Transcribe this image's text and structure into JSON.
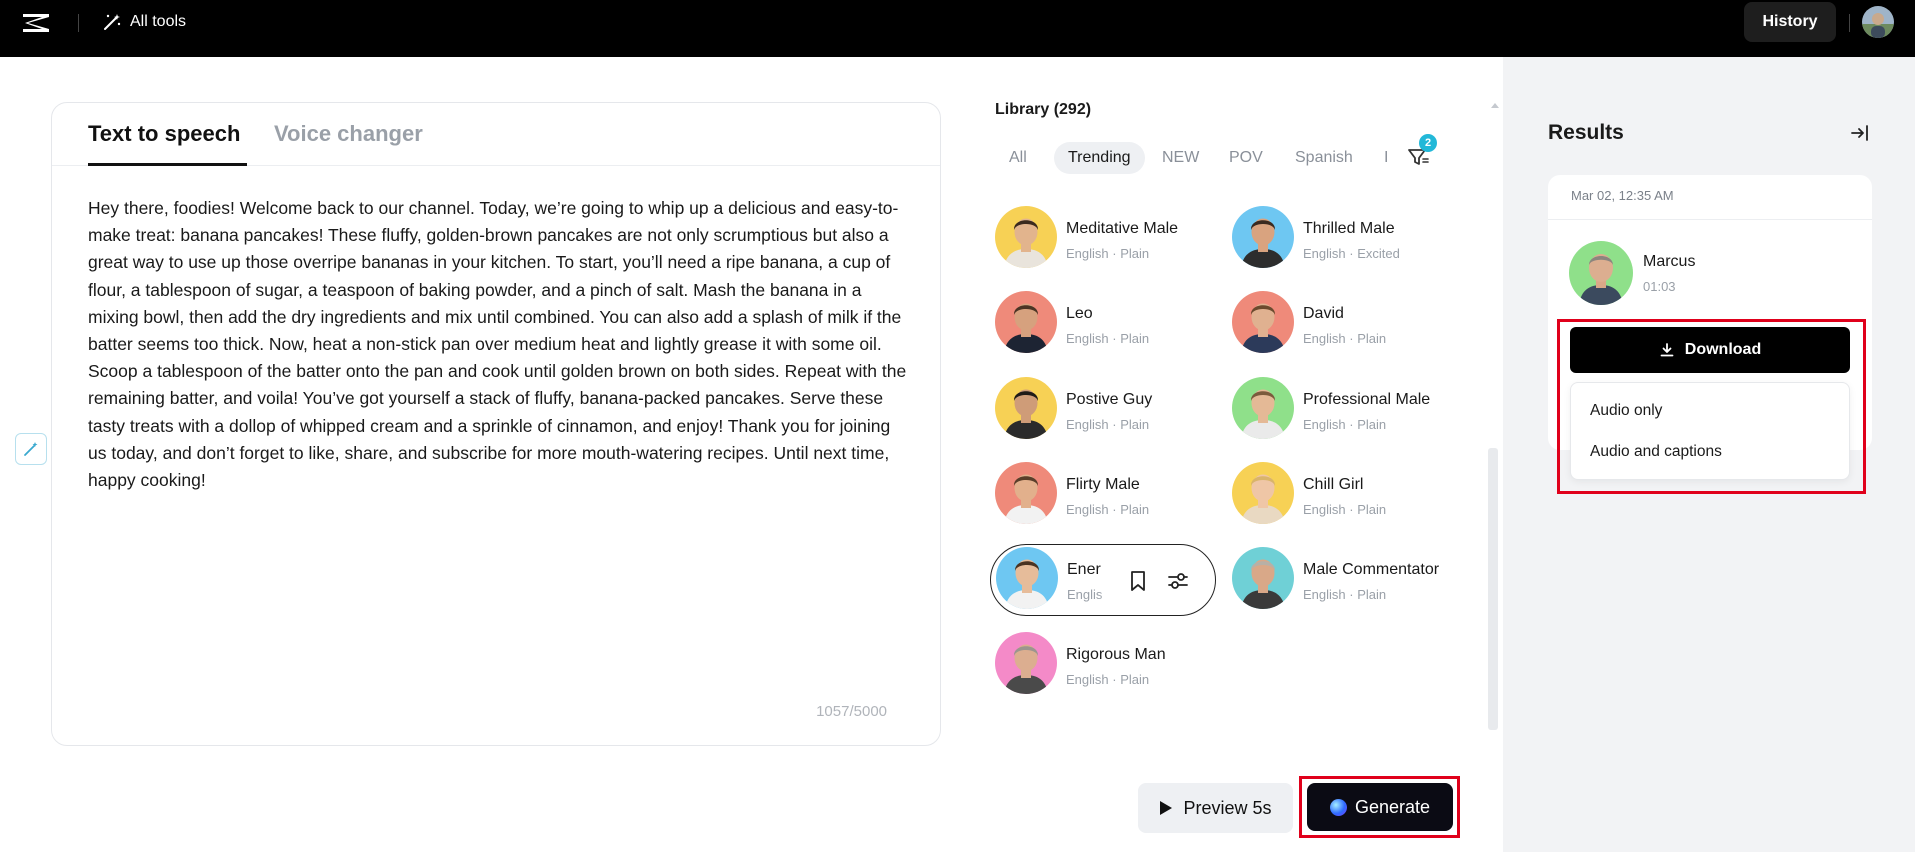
{
  "topbar": {
    "all_tools_label": "All tools",
    "history_label": "History",
    "icons": {
      "logo": "capcut-logo",
      "wand": "magic-wand-icon"
    }
  },
  "editor": {
    "tabs": [
      {
        "label": "Text to speech",
        "active": true
      },
      {
        "label": "Voice changer",
        "active": false
      }
    ],
    "text": "Hey there, foodies! Welcome back to our channel. Today, we’re going to whip up a delicious and easy-to-make treat: banana pancakes! These fluffy, golden-brown pancakes are not only scrumptious but also a great way to use up those overripe bananas in your kitchen. To start, you’ll need a ripe banana, a cup of flour, a tablespoon of sugar, a teaspoon of baking powder, and a pinch of salt. Mash the banana in a mixing bowl, then add the dry ingredients and mix until combined. You can also add a splash of milk if the batter seems too thick. Now, heat a non-stick pan over medium heat and lightly grease it with some oil. Scoop a tablespoon of the batter onto the pan and cook until golden brown on both sides. Repeat with the remaining batter, and voila! You’ve got yourself a stack of fluffy, banana-packed pancakes. Serve these tasty treats with a dollop of whipped cream and a sprinkle of cinnamon, and enjoy! Thank you for joining us today, and don’t forget to like, share, and subscribe for more mouth-watering recipes. Until next time, happy cooking!",
    "char_count": "1057/5000"
  },
  "library": {
    "title": "Library (292)",
    "filters": [
      {
        "label": "All",
        "active": false
      },
      {
        "label": "Trending",
        "active": true
      },
      {
        "label": "NEW",
        "active": false
      },
      {
        "label": "POV",
        "active": false
      },
      {
        "label": "Spanish",
        "active": false
      },
      {
        "label": "I",
        "active": false
      }
    ],
    "filter_badge": "2",
    "voices": [
      {
        "name": "Meditative Male",
        "meta": "English · Plain",
        "bg": "#f7d155",
        "skin": "#e2b48d",
        "hair": "#3b2a1e",
        "shirt": "#e9e4dc"
      },
      {
        "name": "Thrilled Male",
        "meta": "English · Excited",
        "bg": "#6ec7f2",
        "skin": "#d9a37f",
        "hair": "#3a2a20",
        "shirt": "#2d2d2d"
      },
      {
        "name": "Leo",
        "meta": "English · Plain",
        "bg": "#ef8a7a",
        "skin": "#d6a17e",
        "hair": "#4b3424",
        "shirt": "#1d2433"
      },
      {
        "name": "David",
        "meta": "English · Plain",
        "bg": "#ef8a7a",
        "skin": "#e0b190",
        "hair": "#6b4a2e",
        "shirt": "#2c3a5a"
      },
      {
        "name": "Postive Guy",
        "meta": "English · Plain",
        "bg": "#f7d155",
        "skin": "#cf9c78",
        "hair": "#1f1a17",
        "shirt": "#2b2b2b"
      },
      {
        "name": "Professional Male",
        "meta": "English · Plain",
        "bg": "#8fe08a",
        "skin": "#e4b996",
        "hair": "#7b5b3c",
        "shirt": "#eaeaea"
      },
      {
        "name": "Flirty Male",
        "meta": "English · Plain",
        "bg": "#ef8a7a",
        "skin": "#e2b08c",
        "hair": "#5a3e2a",
        "shirt": "#f2f2f2"
      },
      {
        "name": "Chill Girl",
        "meta": "English · Plain",
        "bg": "#f7d155",
        "skin": "#efc6a6",
        "hair": "#d9b46a",
        "shirt": "#e9d9c2"
      },
      {
        "name": "Energetic Male",
        "meta": "English · Plain",
        "bg": "#6ec7f2",
        "skin": "#e6bc9a",
        "hair": "#4a3322",
        "shirt": "#f2f2f2"
      },
      {
        "name": "Male Commentator",
        "meta": "English · Plain",
        "bg": "#6fd0d6",
        "skin": "#d9a888",
        "hair": "#b8b0a6",
        "shirt": "#3a3a3a"
      },
      {
        "name": "Rigorous Man",
        "meta": "English · Plain",
        "bg": "#f48ac8",
        "skin": "#dcae90",
        "hair": "#9c958e",
        "shirt": "#4a4a4a"
      }
    ],
    "selected_voice_display": {
      "name": "Ener",
      "meta": "Englis"
    }
  },
  "actions": {
    "preview_label": "Preview 5s",
    "generate_label": "Generate"
  },
  "results": {
    "title": "Results",
    "date": "Mar 02, 12:35 AM",
    "voice_name": "Marcus",
    "duration": "01:03",
    "download_label": "Download",
    "download_options": [
      "Audio only",
      "Audio and captions"
    ]
  }
}
